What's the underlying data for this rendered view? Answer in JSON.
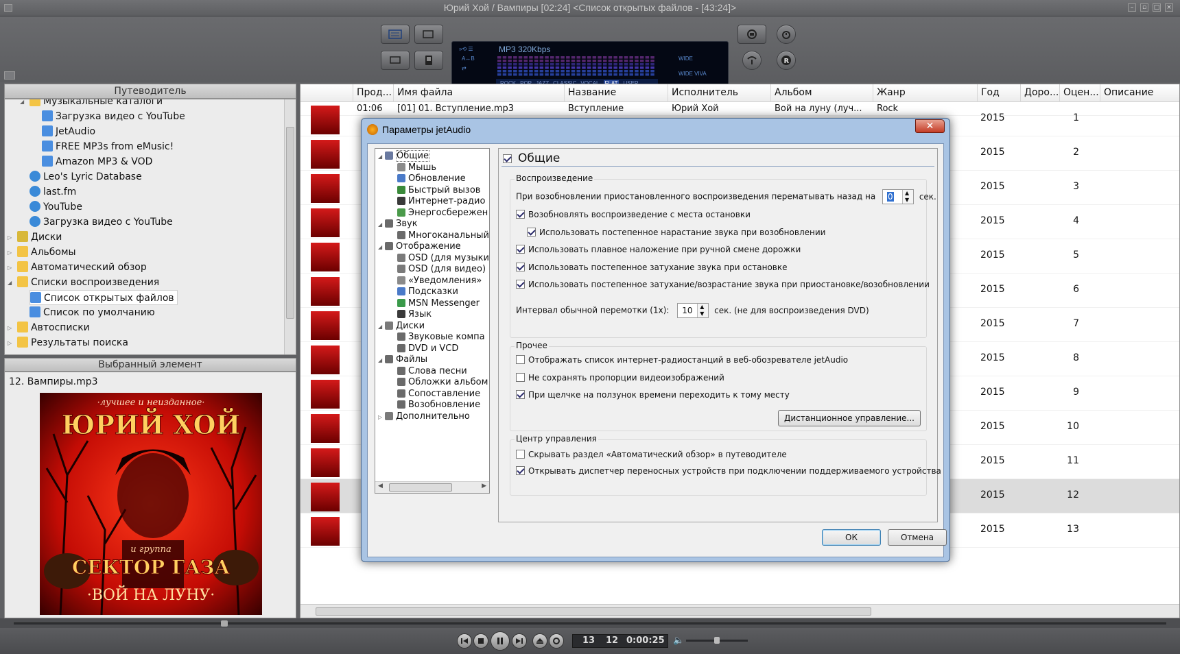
{
  "window": {
    "title": "Юрий Хой / Вампиры  [02:24]    <Список открытых файлов - [43:24]>"
  },
  "toolbar": {
    "lcd_format": "MP3 320Kbps",
    "eq_presets": [
      "ROCK",
      "POP",
      "JAZZ",
      "CLASSIC",
      "VOCAL",
      "FLAT",
      "USER"
    ],
    "eq_active": "FLAT",
    "fx1": "WIDE",
    "fx2": "WIDE VIVA"
  },
  "navigator": {
    "header": "Путеводитель",
    "items": [
      {
        "label": "Музыкальные каталоги",
        "level": 1,
        "icon": "folder-icon",
        "expanded": true
      },
      {
        "label": "Загрузка видео с YouTube",
        "level": 2,
        "icon": "star-link-icon"
      },
      {
        "label": "JetAudio",
        "level": 2,
        "icon": "star-link-icon"
      },
      {
        "label": "FREE MP3s from eMusic!",
        "level": 2,
        "icon": "star-link-icon"
      },
      {
        "label": "Amazon MP3 & VOD",
        "level": 2,
        "icon": "star-link-icon"
      },
      {
        "label": "Leo's Lyric Database",
        "level": 1,
        "icon": "globe-icon"
      },
      {
        "label": "last.fm",
        "level": 1,
        "icon": "globe-icon"
      },
      {
        "label": "YouTube",
        "level": 1,
        "icon": "globe-icon"
      },
      {
        "label": "Загрузка видео с YouTube",
        "level": 1,
        "icon": "globe-icon"
      },
      {
        "label": "Диски",
        "level": 0,
        "icon": "disc-icon",
        "expandable": true
      },
      {
        "label": "Альбомы",
        "level": 0,
        "icon": "folder-icon",
        "expandable": true
      },
      {
        "label": "Автоматический обзор",
        "level": 0,
        "icon": "folder-icon",
        "expandable": true
      },
      {
        "label": "Списки воспроизведения",
        "level": 0,
        "icon": "folder-icon",
        "expanded": true
      },
      {
        "label": "Список открытых файлов",
        "level": 1,
        "icon": "playlist-icon",
        "selected": true
      },
      {
        "label": "Список по умолчанию",
        "level": 1,
        "icon": "playlist-icon"
      },
      {
        "label": "Автосписки",
        "level": 0,
        "icon": "folder-icon",
        "expandable": true
      },
      {
        "label": "Результаты поиска",
        "level": 0,
        "icon": "folder-icon",
        "expandable": true
      }
    ]
  },
  "selected": {
    "header": "Выбранный элемент",
    "file": "12. Вампиры.mp3",
    "cover_top": "·лучшее и неизданное·",
    "cover_artist": "ЮРИЙ ХОЙ",
    "cover_group": "и группа",
    "cover_band": "СЕКТОР ГАЗА",
    "cover_album": "·ВОЙ НА ЛУНУ·"
  },
  "filelist": {
    "columns": [
      "Прод...",
      "Имя файла",
      "Название",
      "Исполнитель",
      "Альбом",
      "Жанр",
      "Год",
      "Доро...",
      "Оцен...",
      "Описание"
    ],
    "partial_row": [
      "01:06",
      "[01] 01. Вступление.mp3",
      "Вступление",
      "Юрий Хой",
      "Вой на луну (луч...",
      "Rock"
    ],
    "rows": [
      {
        "year": "2015",
        "track": "1"
      },
      {
        "year": "2015",
        "track": "2"
      },
      {
        "year": "2015",
        "track": "3"
      },
      {
        "year": "2015",
        "track": "4"
      },
      {
        "year": "2015",
        "track": "5"
      },
      {
        "year": "2015",
        "track": "6"
      },
      {
        "year": "2015",
        "track": "7"
      },
      {
        "year": "2015",
        "track": "8"
      },
      {
        "year": "2015",
        "track": "9"
      },
      {
        "year": "2015",
        "track": "10"
      },
      {
        "year": "2015",
        "track": "11"
      },
      {
        "year": "2015",
        "track": "12",
        "selected": true
      },
      {
        "year": "2015",
        "track": "13"
      }
    ]
  },
  "player": {
    "track_count": "13",
    "current_track": "12",
    "elapsed": "0:00:25",
    "seek_fraction": 0.18,
    "volume_fraction": 0.45
  },
  "dialog": {
    "title": "Параметры jetAudio",
    "close_label": "✕",
    "tree": [
      {
        "label": "Общие",
        "level": 0,
        "selected": true
      },
      {
        "label": "Мышь",
        "level": 1
      },
      {
        "label": "Обновление",
        "level": 1
      },
      {
        "label": "Быстрый вызов",
        "level": 1
      },
      {
        "label": "Интернет-радио",
        "level": 1
      },
      {
        "label": "Энергосбережен",
        "level": 1
      },
      {
        "label": "Звук",
        "level": 0
      },
      {
        "label": "Многоканальный",
        "level": 1
      },
      {
        "label": "Отображение",
        "level": 0
      },
      {
        "label": "OSD (для музыки",
        "level": 1
      },
      {
        "label": "OSD (для видео)",
        "level": 1
      },
      {
        "label": "«Уведомления»",
        "level": 1
      },
      {
        "label": "Подсказки",
        "level": 1
      },
      {
        "label": "MSN Messenger",
        "level": 1
      },
      {
        "label": "Язык",
        "level": 1
      },
      {
        "label": "Диски",
        "level": 0
      },
      {
        "label": "Звуковые компа",
        "level": 1
      },
      {
        "label": "DVD и VCD",
        "level": 1
      },
      {
        "label": "Файлы",
        "level": 0
      },
      {
        "label": "Слова песни",
        "level": 1
      },
      {
        "label": "Обложки альбом",
        "level": 1
      },
      {
        "label": "Сопоставление",
        "level": 1
      },
      {
        "label": "Возобновление",
        "level": 1
      },
      {
        "label": "Дополнительно",
        "level": 0
      }
    ],
    "page_title": "Общие",
    "playback": {
      "label": "Воспроизведение",
      "rewind_text": "При возобновлении приостановленного воспроизведения перематывать назад на",
      "rewind_value": "0",
      "rewind_unit": "сек.",
      "options": [
        {
          "text": "Возобновлять воспроизведение с места остановки",
          "checked": true,
          "indent": false
        },
        {
          "text": "Использовать постепенное нарастание звука при возобновлении",
          "checked": true,
          "indent": true
        },
        {
          "text": "Использовать плавное наложение при ручной смене дорожки",
          "checked": true,
          "indent": false
        },
        {
          "text": "Использовать постепенное затухание звука при остановке",
          "checked": true,
          "indent": false
        },
        {
          "text": "Использовать постепенное затухание/возрастание звука при приостановке/возобновлении",
          "checked": true,
          "indent": false
        }
      ],
      "interval_text": "Интервал обычной перемотки (1x):",
      "interval_value": "10",
      "interval_unit": "сек. (не для воспроизведения DVD)"
    },
    "misc": {
      "label": "Прочее",
      "options": [
        {
          "text": "Отображать список интернет-радиостанций в веб-обозревателе jetAudio",
          "checked": false
        },
        {
          "text": "Не сохранять пропорции видеоизображений",
          "checked": false
        },
        {
          "text": "При щелчке на ползунок времени переходить к тому месту",
          "checked": true
        }
      ],
      "remote_button": "Дистанционное управление..."
    },
    "control": {
      "label": "Центр управления",
      "options": [
        {
          "text": "Скрывать раздел «Автоматический обзор» в путеводителе",
          "checked": false
        },
        {
          "text": "Открывать диспетчер переносных устройств при подключении поддерживаемого устройства",
          "checked": true
        }
      ]
    },
    "ok": "ОК",
    "cancel": "Отмена"
  }
}
